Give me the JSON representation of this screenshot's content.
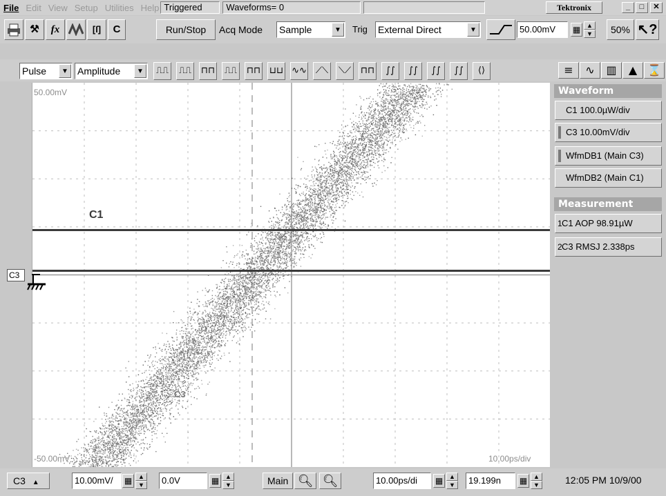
{
  "menubar": {
    "items": [
      {
        "label": "File",
        "enabled": true
      },
      {
        "label": "Edit",
        "enabled": false
      },
      {
        "label": "View",
        "enabled": false
      },
      {
        "label": "Setup",
        "enabled": false
      },
      {
        "label": "Utilities",
        "enabled": false
      },
      {
        "label": "Help",
        "enabled": false
      }
    ],
    "status": "Triggered",
    "waveforms": "Waveforms= 0",
    "brand": "Tektronix",
    "window_buttons": [
      "_",
      "□",
      "✕"
    ]
  },
  "toolbar": {
    "icons": [
      "printer-icon",
      "tools-icon",
      "function-icon",
      "waveform-icon",
      "cursor-icon"
    ],
    "c_label": "C",
    "run_stop": "Run/Stop",
    "acq_mode_label": "Acq Mode",
    "acq_mode_value": "Sample",
    "trig_label": "Trig",
    "trig_value": "External Direct",
    "trig_level": "50.00mV",
    "fifty_percent": "50%",
    "help": "?"
  },
  "meas_toolbar": {
    "category": "Pulse",
    "measurement": "Amplitude",
    "meas_icons": 17,
    "view_buttons": [
      "≡",
      "⩘",
      "▦",
      "▲",
      "⌛"
    ]
  },
  "scope": {
    "top_label": "50.00mV",
    "bottom_label": "-50.00mV",
    "timebase_label": "10.00ps/div",
    "trace_c1_label": "C1",
    "trace_c3_label": "C3",
    "c3_marker": "C3"
  },
  "waveform_panel": {
    "title": "Waveform",
    "items": [
      "C1 100.0µW/div",
      "C3 10.00mV/div",
      "WfmDB1 (Main C3)",
      "WfmDB2 (Main C1)"
    ]
  },
  "measurement_panel": {
    "title": "Measurement",
    "items": [
      {
        "num": "1",
        "text": "C1 AOP  98.91µW"
      },
      {
        "num": "2",
        "text": "C3 RMSJ 2.338ps"
      }
    ]
  },
  "bottombar": {
    "channel": "C3",
    "vertical_scale": "10.00mV/",
    "offset": "0.0V",
    "main_button": "Main",
    "horizontal_scale": "10.00ps/di",
    "position": "19.199n",
    "datetime": "12:05 PM 10/9/00"
  }
}
